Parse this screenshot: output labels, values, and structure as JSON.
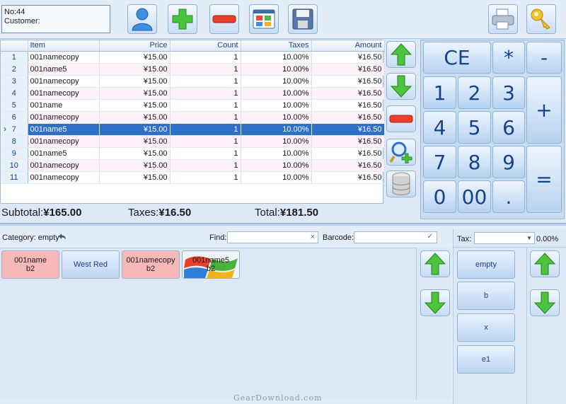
{
  "ticket": {
    "no": "No:44",
    "customer": "Customer:"
  },
  "grid": {
    "columns": [
      "Item",
      "Price",
      "Count",
      "Taxes",
      "Amount"
    ],
    "rows": [
      {
        "n": "1",
        "item": "001namecopy",
        "price": "¥15.00",
        "count": "1",
        "taxes": "10.00%",
        "amount": "¥16.50"
      },
      {
        "n": "2",
        "item": "001name5",
        "price": "¥15.00",
        "count": "1",
        "taxes": "10.00%",
        "amount": "¥16.50"
      },
      {
        "n": "3",
        "item": "001namecopy",
        "price": "¥15.00",
        "count": "1",
        "taxes": "10.00%",
        "amount": "¥16.50"
      },
      {
        "n": "4",
        "item": "001namecopy",
        "price": "¥15.00",
        "count": "1",
        "taxes": "10.00%",
        "amount": "¥16.50"
      },
      {
        "n": "5",
        "item": "001name",
        "price": "¥15.00",
        "count": "1",
        "taxes": "10.00%",
        "amount": "¥16.50"
      },
      {
        "n": "6",
        "item": "001namecopy",
        "price": "¥15.00",
        "count": "1",
        "taxes": "10.00%",
        "amount": "¥16.50"
      },
      {
        "n": "7",
        "item": "001name5",
        "price": "¥15.00",
        "count": "1",
        "taxes": "10.00%",
        "amount": "¥16.50"
      },
      {
        "n": "8",
        "item": "001namecopy",
        "price": "¥15.00",
        "count": "1",
        "taxes": "10.00%",
        "amount": "¥16.50"
      },
      {
        "n": "9",
        "item": "001name5",
        "price": "¥15.00",
        "count": "1",
        "taxes": "10.00%",
        "amount": "¥16.50"
      },
      {
        "n": "10",
        "item": "001namecopy",
        "price": "¥15.00",
        "count": "1",
        "taxes": "10.00%",
        "amount": "¥16.50"
      },
      {
        "n": "11",
        "item": "001namecopy",
        "price": "¥15.00",
        "count": "1",
        "taxes": "10.00%",
        "amount": "¥16.50"
      }
    ],
    "selected_row": "7"
  },
  "totals": {
    "subtotal_label": "Subtotal:",
    "subtotal": "¥165.00",
    "taxes_label": "Taxes:",
    "taxes": "¥16.50",
    "total_label": "Total:",
    "total": "¥181.50"
  },
  "keypad": {
    "ce": "CE",
    "multiply": "*",
    "minus": "-",
    "plus": "+",
    "equals": "=",
    "k1": "1",
    "k2": "2",
    "k3": "3",
    "k4": "4",
    "k5": "5",
    "k6": "6",
    "k7": "7",
    "k8": "8",
    "k9": "9",
    "k0": "0",
    "k00": "00",
    "dot": "."
  },
  "filter": {
    "category_label": "Category: empty",
    "find_label": "Find:",
    "barcode_label": "Barcode:",
    "clear_glyph": "×",
    "check_glyph": "✓"
  },
  "products": [
    {
      "line1": "001name",
      "line2": "b2",
      "style": "pink"
    },
    {
      "line1": "West Red",
      "line2": "",
      "style": "blue"
    },
    {
      "line1": "001namecopy",
      "line2": "b2",
      "style": "pink"
    },
    {
      "line1": "001name5",
      "line2": "b2",
      "style": "image"
    }
  ],
  "tax": {
    "label": "Tax:",
    "percent": "0.00%",
    "items": [
      "empty",
      "b",
      "x",
      "e1"
    ]
  },
  "icons": {
    "customer": "person-icon",
    "add": "plus-icon",
    "remove": "minus-icon",
    "layout": "window-layout-icon",
    "save": "floppy-disk-icon",
    "print": "printer-icon",
    "key": "key-icon",
    "up": "arrow-up-icon",
    "down": "arrow-down-icon",
    "search_add": "search-add-icon",
    "database": "database-icon"
  },
  "colors": {
    "selection": "#2f6fc6",
    "accent_text": "#15428b",
    "green_arrow": "#3aa43a"
  },
  "watermark": "GearDownload.com"
}
